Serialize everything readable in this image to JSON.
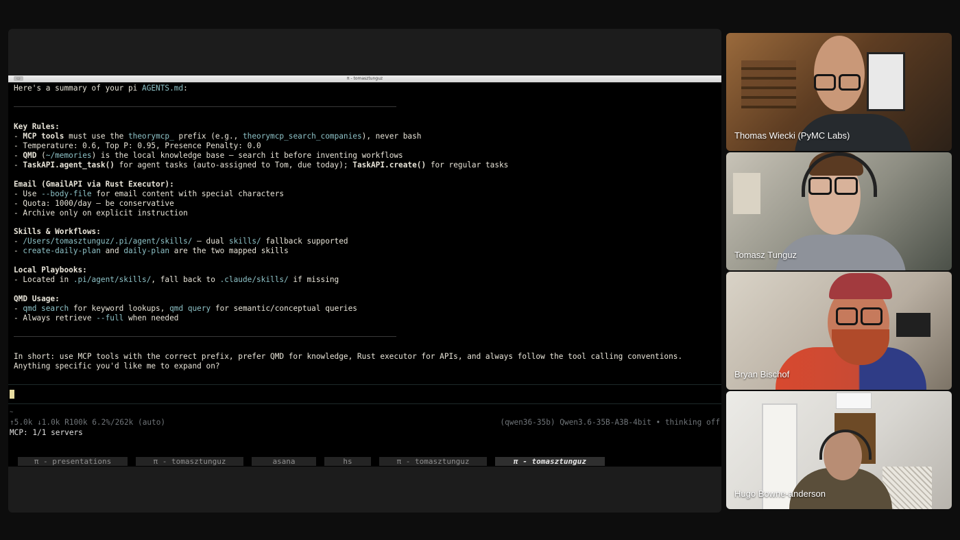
{
  "terminal": {
    "window_title": "π - tomasztunguz",
    "lines": [
      [
        {
          "t": "Here's a summary of your pi "
        },
        {
          "t": "AGENTS.md",
          "c": "hl"
        },
        {
          "t": ":"
        }
      ],
      [
        {
          "t": "Key Rules:",
          "c": "b"
        }
      ],
      [
        {
          "t": "- "
        },
        {
          "t": "MCP tools",
          "c": "b"
        },
        {
          "t": " must use the "
        },
        {
          "t": "theorymcp_",
          "c": "hl"
        },
        {
          "t": " prefix (e.g., "
        },
        {
          "t": "theorymcp_search_companies",
          "c": "hl"
        },
        {
          "t": "), never bash"
        }
      ],
      [
        {
          "t": "- Temperature: 0.6, Top P: 0.95, Presence Penalty: 0.0"
        }
      ],
      [
        {
          "t": "- "
        },
        {
          "t": "QMD",
          "c": "b"
        },
        {
          "t": " ("
        },
        {
          "t": "~/memories",
          "c": "hl"
        },
        {
          "t": ") is the local knowledge base — search it before inventing workflows"
        }
      ],
      [
        {
          "t": "- "
        },
        {
          "t": "TaskAPI.agent_task()",
          "c": "b"
        },
        {
          "t": " for agent tasks (auto-assigned to Tom, due today); "
        },
        {
          "t": "TaskAPI.create()",
          "c": "b"
        },
        {
          "t": " for regular tasks"
        }
      ],
      [
        {
          "t": "Email (GmailAPI via Rust Executor):",
          "c": "b"
        }
      ],
      [
        {
          "t": "- Use "
        },
        {
          "t": "--body-file",
          "c": "hl"
        },
        {
          "t": " for email content with special characters"
        }
      ],
      [
        {
          "t": "- Quota: 1000/day — be conservative"
        }
      ],
      [
        {
          "t": "- Archive only on explicit instruction"
        }
      ],
      [
        {
          "t": "Skills & Workflows:",
          "c": "b"
        }
      ],
      [
        {
          "t": "- "
        },
        {
          "t": "/Users/tomasztunguz/.pi/agent/skills/",
          "c": "hl"
        },
        {
          "t": " — dual "
        },
        {
          "t": "skills/",
          "c": "hl"
        },
        {
          "t": " fallback supported"
        }
      ],
      [
        {
          "t": "- "
        },
        {
          "t": "create-daily-plan",
          "c": "hl"
        },
        {
          "t": " and "
        },
        {
          "t": "daily-plan",
          "c": "hl"
        },
        {
          "t": " are the two mapped skills"
        }
      ],
      [
        {
          "t": "Local Playbooks:",
          "c": "b"
        }
      ],
      [
        {
          "t": "- Located in "
        },
        {
          "t": ".pi/agent/skills/",
          "c": "hl"
        },
        {
          "t": ", fall back to "
        },
        {
          "t": ".claude/skills/",
          "c": "hl"
        },
        {
          "t": " if missing"
        }
      ],
      [
        {
          "t": "QMD Usage:",
          "c": "b"
        }
      ],
      [
        {
          "t": "- "
        },
        {
          "t": "qmd search",
          "c": "hl"
        },
        {
          "t": " for keyword lookups, "
        },
        {
          "t": "qmd query",
          "c": "hl"
        },
        {
          "t": " for semantic/conceptual queries"
        }
      ],
      [
        {
          "t": "- Always retrieve "
        },
        {
          "t": "--full",
          "c": "hl"
        },
        {
          "t": " when needed"
        }
      ],
      [
        {
          "t": "In short: use MCP tools with the correct prefix, prefer QMD for knowledge, Rust executor for APIs, and always follow the tool calling conventions."
        }
      ],
      [
        {
          "t": "Anything specific you'd like me to expand on?"
        }
      ]
    ],
    "status_tilde": "~",
    "status_usage": "↑5.0k ↓1.0k R100k 6.2%/262k (auto)",
    "status_model": "(qwen36-35b) Qwen3.6-35B-A3B-4bit • thinking off",
    "mcp_status": "MCP: 1/1 servers",
    "tabs": [
      "π - presentations",
      "π - tomasztunguz",
      "asana",
      "hs",
      "π - tomasztunguz",
      "π - tomasztunguz"
    ]
  },
  "participants": [
    {
      "name": "Thomas Wiecki (PyMC Labs)"
    },
    {
      "name": "Tomasz Tunguz"
    },
    {
      "name": "Bryan Bischof"
    },
    {
      "name": "Hugo Bowne-anderson"
    }
  ]
}
